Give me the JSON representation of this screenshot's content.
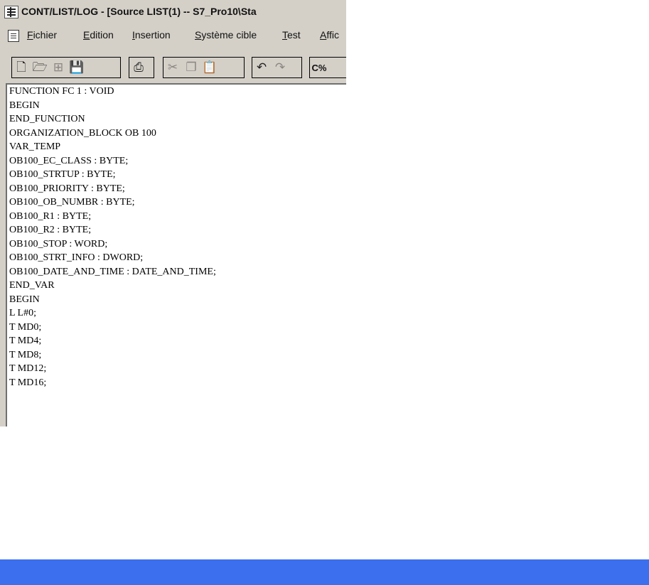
{
  "window": {
    "title": "CONT/LIST/LOG - [Source LIST(1) -- S7_Pro10\\Sta"
  },
  "menu": {
    "items": [
      {
        "label": "Fichier"
      },
      {
        "label": "Edition"
      },
      {
        "label": "Insertion"
      },
      {
        "label": "Système cible"
      },
      {
        "label": "Test"
      },
      {
        "label": "Affic"
      }
    ]
  },
  "toolbar": {
    "buttons": [
      {
        "name": "new-icon",
        "glyph": "🗋"
      },
      {
        "name": "open-icon",
        "glyph": "🗁"
      },
      {
        "name": "accessible-nodes-icon",
        "glyph": "⊞"
      },
      {
        "name": "save-icon",
        "glyph": "💾"
      },
      {
        "name": "print-icon",
        "glyph": "⎙"
      },
      {
        "name": "cut-icon",
        "glyph": "✂"
      },
      {
        "name": "copy-icon",
        "glyph": "❐"
      },
      {
        "name": "paste-icon",
        "glyph": "📋"
      },
      {
        "name": "undo-icon",
        "glyph": "↶"
      },
      {
        "name": "redo-icon",
        "glyph": "↷"
      },
      {
        "name": "compile-label",
        "glyph": "C%"
      }
    ]
  },
  "editor": {
    "lines": [
      "FUNCTION FC 1 : VOID",
      "BEGIN",
      "END_FUNCTION",
      "ORGANIZATION_BLOCK OB 100",
      "VAR_TEMP",
      "OB100_EC_CLASS : BYTE;",
      "OB100_STRTUP : BYTE;",
      "OB100_PRIORITY : BYTE;",
      "OB100_OB_NUMBR : BYTE;",
      "OB100_R1 : BYTE;",
      "OB100_R2 : BYTE;",
      "OB100_STOP : WORD;",
      "OB100_STRT_INFO : DWORD;",
      "OB100_DATE_AND_TIME : DATE_AND_TIME;",
      "END_VAR",
      "BEGIN",
      "L L#0;",
      "T MD0;",
      "T MD4;",
      "T MD8;",
      "T MD12;",
      "T MD16;"
    ]
  },
  "colors": {
    "window_face": "#d4d0c8",
    "editor_bg": "#ffffff",
    "bottom_bar": "#3b6fee"
  }
}
